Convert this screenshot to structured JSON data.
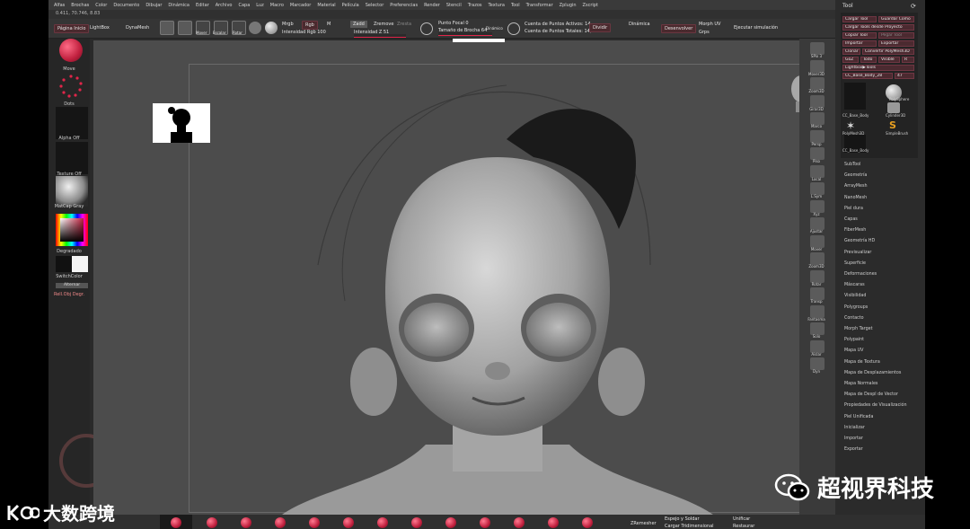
{
  "menu": [
    "Alfas",
    "Brochas",
    "Color",
    "Documento",
    "Dibujar",
    "Dinámica",
    "Editar",
    "Archivo",
    "Capa",
    "Luz",
    "Macro",
    "Marcador",
    "Material",
    "Película",
    "Selector",
    "Preferencias",
    "Render",
    "Stencil",
    "Trazos",
    "Textura",
    "Tool",
    "Transformar",
    "Zplugin",
    "Zscript"
  ],
  "coords": "0.411, 70.746, 8.83",
  "top_shelf": {
    "pagina_inicio": "Página Inicio",
    "lightbox": "LightBox",
    "dynamesh": "DynaMesh",
    "editar": "Editar",
    "dibujar": "Dibujar",
    "mover": "Mover",
    "escalar": "Escalar",
    "rotar": "Rotar",
    "mrgb": "Mrgb",
    "rgb": "Rgb",
    "m": "M",
    "intensidad_rgb": "Intensidad Rgb 100",
    "zadd": "Zadd",
    "zintensidad": "Intensidad Z 51",
    "zremove": "Zremove",
    "zrest": "Zresta",
    "punto_focal": "Punto Focal 0",
    "tamano_brocha": "Tamaño de Brocha 64",
    "dinamica_small": "Dinámico",
    "puntos_activos": "Cuenta de Puntos Activos: 14,",
    "puntos_totales": "Cuenta de Puntos Totales: 14,",
    "dividir": "Dividir",
    "dinamica": "Dinámica",
    "desenvolver": "Desenvolver",
    "morph_uv": "Morph UV",
    "grps": "Grps",
    "ejecutar": "Ejecutar simulación"
  },
  "left_shelf": {
    "move": "Move",
    "dots": "Dots",
    "alpha": "Alpha Off",
    "texture": "Texture Off",
    "matcap": "MatCap Gray",
    "degradado": "Degradado",
    "switch_color": "SwitchColor",
    "alternar": "Alternar",
    "rell_obj": "Rell.Obj Degr."
  },
  "right_shelf": [
    "SPix 3",
    "Mover3D",
    "Zoom3D",
    "Girar3D",
    "Marco",
    "Persp",
    "Piso",
    "Local",
    "L.Sym",
    "Xyz",
    "Ajustar",
    "Mover",
    "Zoom3D",
    "Rotar",
    "Transp",
    "Fantasma",
    "Solo",
    "Aislar",
    "Dyn"
  ],
  "tool_panel": {
    "title": "Tool",
    "buttons_row1": [
      "Cargar Tool",
      "Guardar Como"
    ],
    "buttons_row2": [
      "Cargar Tools desde Proyecto"
    ],
    "buttons_row3": [
      "Copiar Tool",
      "Pegar Tool"
    ],
    "buttons_row4": [
      "Importar",
      "Exportar"
    ],
    "buttons_row5": [
      "Clonar",
      "Convertir PolyMesh3D"
    ],
    "buttons_row6": [
      "GoZ",
      "Todo",
      "Visible",
      "R"
    ],
    "lightbox_tools": "Lightbox▶Tools",
    "current_tool": "CC_Base_Body_28",
    "current_count": "47",
    "tools": [
      "CC_Base_Body",
      "PolySphere",
      "CC_Base_Body",
      "Cylinder3D",
      "PolyMesh3D",
      "SimpleBrush",
      "CC_Base_Body"
    ],
    "menu_items": [
      "SubTool",
      "Geometría",
      "ArrayMesh",
      "NanoMesh",
      "Piel dura",
      "Capas",
      "FiberMesh",
      "Geometría HD",
      "Previsualizar",
      "Superficie",
      "Deformaciones",
      "Máscaras",
      "Visibilidad",
      "Polygroups",
      "Contacto",
      "Morph Target",
      "Polypaint",
      "Mapa UV",
      "Mapa de Textura",
      "Mapa de Desplazamientos",
      "Mapa Normales",
      "Mapa de Despl de Vector",
      "Propiedades de Visualización",
      "Piel Unificada",
      "Inicializar",
      "Importar",
      "Exportar"
    ]
  },
  "bottom_shelf": {
    "remesh": "ZRemesher",
    "espejo": "Espejo y Soldar",
    "cargar": "Cargar Tridimensional",
    "unificar": "Unificar",
    "restaurar": "Restaurar"
  },
  "watermark_left": "大数跨境",
  "watermark_right": "超视界科技",
  "colors": {
    "accent": "#c0203e",
    "panel": "#2b2b2b",
    "viewport": "#4c4c4c"
  }
}
